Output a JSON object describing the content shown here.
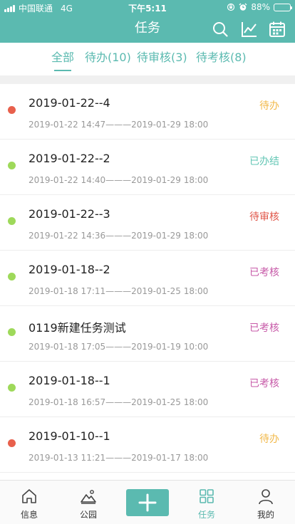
{
  "status": {
    "carrier": "中国联通",
    "network": "4G",
    "time": "下午5:11",
    "battery": "88%",
    "battery_level": 0.88
  },
  "header": {
    "title": "任务"
  },
  "tabs": [
    {
      "label": "全部",
      "active": true
    },
    {
      "label": "待办(10)"
    },
    {
      "label": "待审核(3)"
    },
    {
      "label": "待考核(8)"
    }
  ],
  "tasks": [
    {
      "title": "2019-01-22--4",
      "time": "2019-01-22 14:47———2019-01-29 18:00",
      "status": "待办",
      "status_color": "#f2b94a",
      "dot_color": "#e8604c"
    },
    {
      "title": "2019-01-22--2",
      "time": "2019-01-22 14:40———2019-01-29 18:00",
      "status": "已办结",
      "status_color": "#62c6b4",
      "dot_color": "#9ed95a"
    },
    {
      "title": "2019-01-22--3",
      "time": "2019-01-22 14:36———2019-01-29 18:00",
      "status": "待审核",
      "status_color": "#e0574a",
      "dot_color": "#9ed95a"
    },
    {
      "title": "2019-01-18--2",
      "time": "2019-01-18 17:11———2019-01-25 18:00",
      "status": "已考核",
      "status_color": "#c75aa8",
      "dot_color": "#9ed95a"
    },
    {
      "title": "0119新建任务测试",
      "time": "2019-01-18 17:05———2019-01-19 10:00",
      "status": "已考核",
      "status_color": "#c75aa8",
      "dot_color": "#9ed95a"
    },
    {
      "title": "2019-01-18--1",
      "time": "2019-01-18 16:57———2019-01-25 18:00",
      "status": "已考核",
      "status_color": "#c75aa8",
      "dot_color": "#9ed95a"
    },
    {
      "title": "2019-01-10--1",
      "time": "2019-01-13 11:21———2019-01-17 18:00",
      "status": "待办",
      "status_color": "#f2b94a",
      "dot_color": "#e8604c"
    }
  ],
  "tabbar": [
    {
      "label": "信息",
      "icon": "home-icon"
    },
    {
      "label": "公园",
      "icon": "park-icon"
    },
    {
      "label": "",
      "icon": "plus-icon"
    },
    {
      "label": "任务",
      "icon": "grid-icon",
      "active": true
    },
    {
      "label": "我的",
      "icon": "user-icon"
    }
  ],
  "colors": {
    "primary": "#5bbab0"
  }
}
